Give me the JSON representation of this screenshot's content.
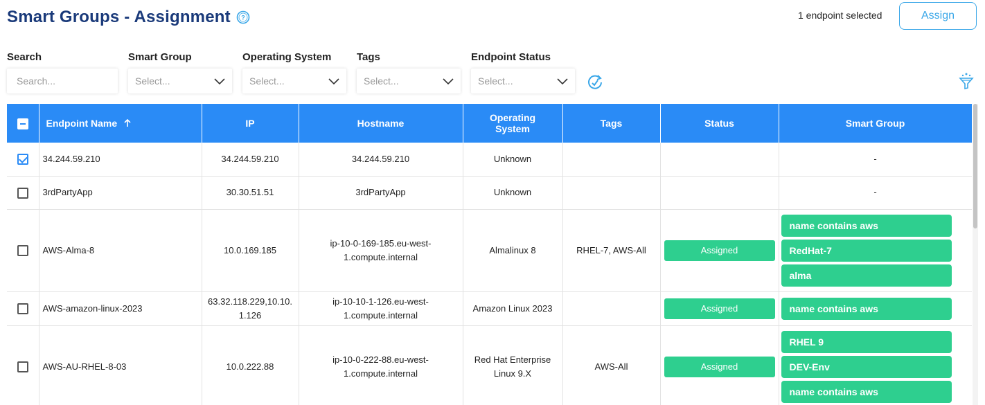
{
  "header": {
    "title": "Smart Groups - Assignment"
  },
  "selection": {
    "count_text": "1 endpoint selected",
    "assign_label": "Assign"
  },
  "filters": {
    "search": {
      "label": "Search",
      "placeholder": "Search..."
    },
    "smart_group": {
      "label": "Smart Group",
      "placeholder": "Select..."
    },
    "os": {
      "label": "Operating System",
      "placeholder": "Select..."
    },
    "tags": {
      "label": "Tags",
      "placeholder": "Select..."
    },
    "status": {
      "label": "Endpoint Status",
      "placeholder": "Select..."
    }
  },
  "table": {
    "columns": {
      "name": "Endpoint Name",
      "ip": "IP",
      "hostname": "Hostname",
      "os": "Operating System",
      "tags": "Tags",
      "status": "Status",
      "smart_group": "Smart Group"
    },
    "rows": [
      {
        "checked": true,
        "name": "34.244.59.210",
        "ip": "34.244.59.210",
        "hostname": "34.244.59.210",
        "os": "Unknown",
        "tags": "",
        "status": "",
        "groups_text": "-"
      },
      {
        "checked": false,
        "name": "3rdPartyApp",
        "ip": "30.30.51.51",
        "hostname": "3rdPartyApp",
        "os": "Unknown",
        "tags": "",
        "status": "",
        "groups_text": "-"
      },
      {
        "checked": false,
        "name": "AWS-Alma-8",
        "ip": "10.0.169.185",
        "hostname": "ip-10-0-169-185.eu-west-1.compute.internal",
        "os": "Almalinux 8",
        "tags": "RHEL-7, AWS-All",
        "status": "Assigned",
        "groups": [
          "name contains aws",
          "RedHat-7",
          "alma"
        ]
      },
      {
        "checked": false,
        "name": "AWS-amazon-linux-2023",
        "ip": "63.32.118.229,10.10.1.126",
        "hostname": "ip-10-10-1-126.eu-west-1.compute.internal",
        "os": "Amazon Linux 2023",
        "tags": "",
        "status": "Assigned",
        "groups": [
          "name contains aws"
        ]
      },
      {
        "checked": false,
        "name": "AWS-AU-RHEL-8-03",
        "ip": "10.0.222.88",
        "hostname": "ip-10-0-222-88.eu-west-1.compute.internal",
        "os": "Red Hat Enterprise Linux 9.X",
        "tags": "AWS-All",
        "status": "Assigned",
        "groups": [
          "RHEL 9",
          "DEV-Env",
          "name contains aws"
        ]
      }
    ]
  },
  "colors": {
    "title": "#1a3a7a",
    "header_bg": "#2a8bf6",
    "accent": "#3aa7e8",
    "pill": "#2ecf8f"
  }
}
